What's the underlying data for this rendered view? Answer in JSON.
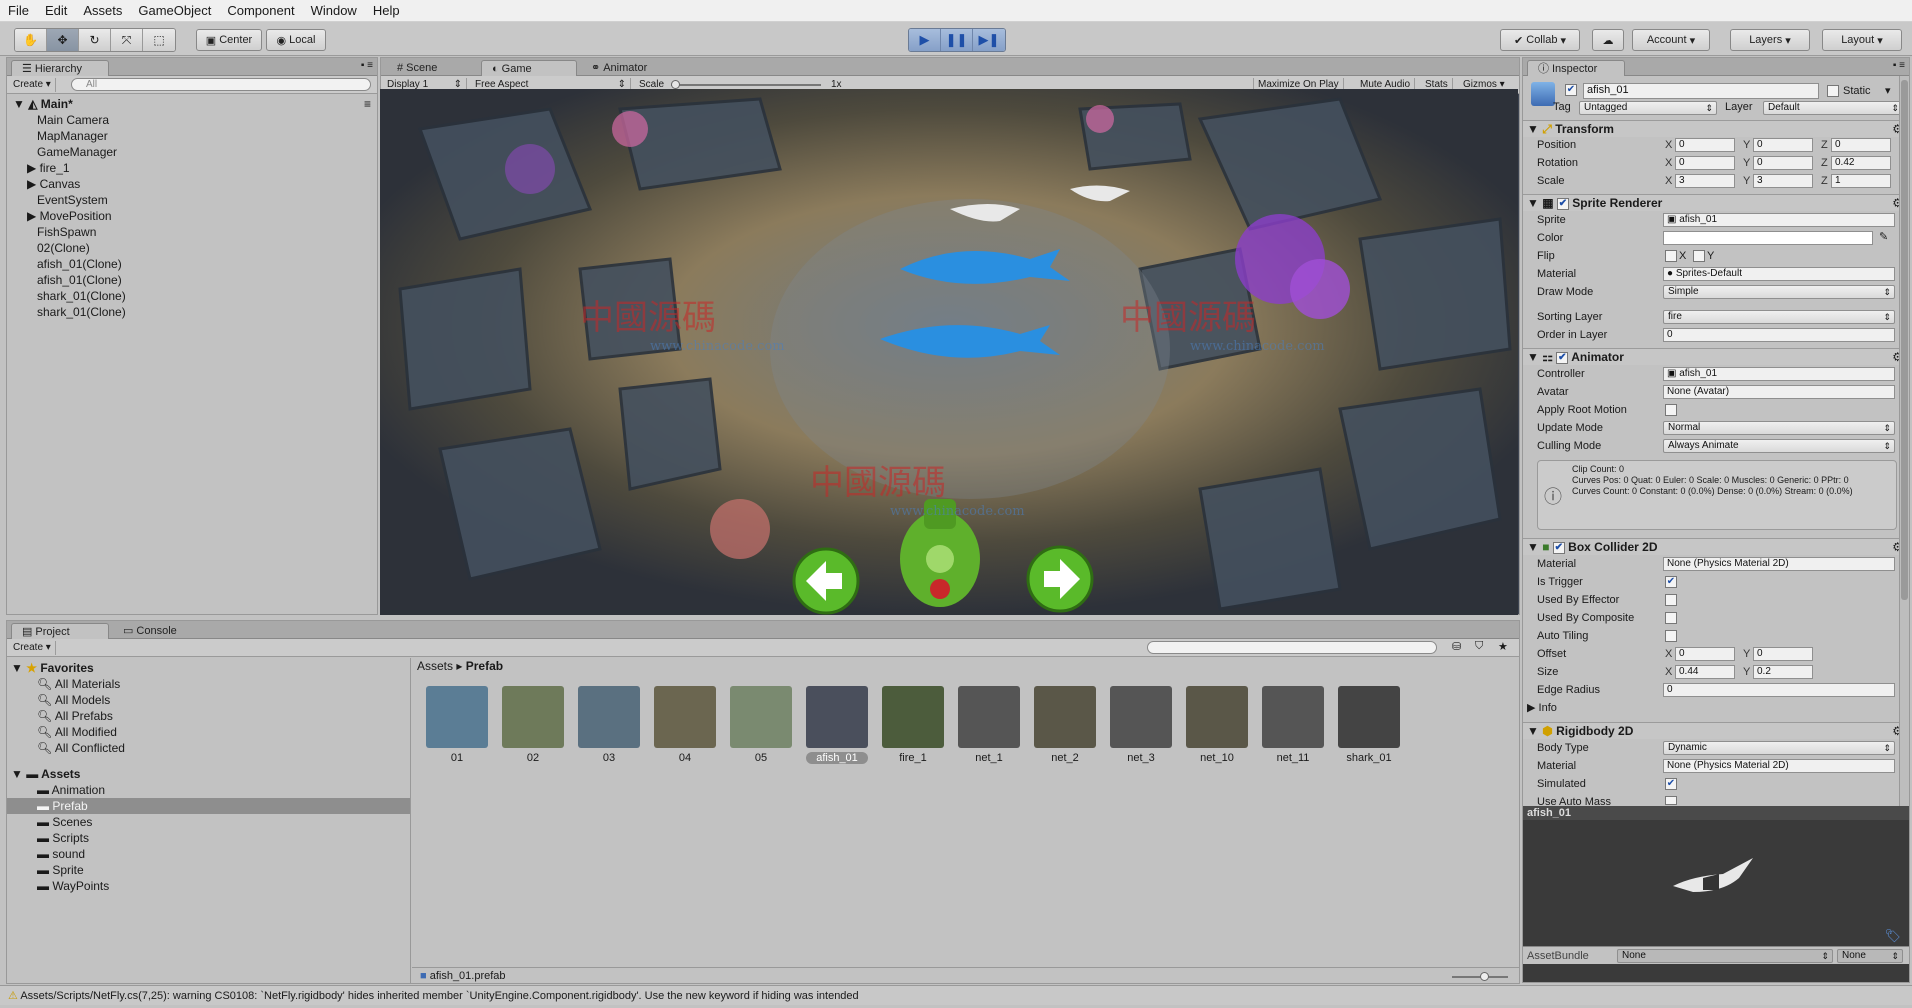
{
  "menu": [
    "File",
    "Edit",
    "Assets",
    "GameObject",
    "Component",
    "Window",
    "Help"
  ],
  "toolbar": {
    "center": "Center",
    "local": "Local",
    "collab": "Collab",
    "account": "Account",
    "layers": "Layers",
    "layout": "Layout"
  },
  "hierarchy": {
    "tab": "Hierarchy",
    "create": "Create",
    "search_placeholder": "All",
    "scene": "Main*",
    "items": [
      "Main Camera",
      "MapManager",
      "GameManager",
      "fire_1",
      "Canvas",
      "EventSystem",
      "MovePosition",
      "FishSpawn",
      "02(Clone)",
      "afish_01(Clone)",
      "afish_01(Clone)",
      "shark_01(Clone)",
      "shark_01(Clone)"
    ]
  },
  "game": {
    "tabs": [
      "Scene",
      "Game",
      "Animator"
    ],
    "display": "Display 1",
    "aspect": "Free Aspect",
    "scale_label": "Scale",
    "scale_value": "1x",
    "maximize": "Maximize On Play",
    "mute": "Mute Audio",
    "stats": "Stats",
    "gizmos": "Gizmos"
  },
  "watermark": {
    "cn": "中國源碼",
    "url": "www.chinacode.com"
  },
  "project": {
    "tabs": [
      "Project",
      "Console"
    ],
    "create": "Create",
    "favorites_label": "Favorites",
    "favorites": [
      "All Materials",
      "All Models",
      "All Prefabs",
      "All Modified",
      "All Conflicted"
    ],
    "assets_label": "Assets",
    "folders": [
      "Animation",
      "Prefab",
      "Scenes",
      "Scripts",
      "sound",
      "Sprite",
      "WayPoints"
    ],
    "breadcrumb_root": "Assets",
    "breadcrumb_current": "Prefab",
    "assets": [
      "01",
      "02",
      "03",
      "04",
      "05",
      "afish_01",
      "fire_1",
      "net_1",
      "net_2",
      "net_3",
      "net_10",
      "net_11",
      "shark_01"
    ],
    "selected_file": "afish_01.prefab"
  },
  "inspector": {
    "tab": "Inspector",
    "object_name": "afish_01",
    "static": "Static",
    "tag_label": "Tag",
    "tag": "Untagged",
    "layer_label": "Layer",
    "layer": "Default",
    "transform": {
      "title": "Transform",
      "position_label": "Position",
      "position": [
        "0",
        "0",
        "0"
      ],
      "rotation_label": "Rotation",
      "rotation": [
        "0",
        "0",
        "0.42"
      ],
      "scale_label": "Scale",
      "scale": [
        "3",
        "3",
        "1"
      ]
    },
    "sprite_renderer": {
      "title": "Sprite Renderer",
      "sprite_label": "Sprite",
      "sprite": "afish_01",
      "color_label": "Color",
      "flip_label": "Flip",
      "flip_x": "X",
      "flip_y": "Y",
      "material_label": "Material",
      "material": "Sprites-Default",
      "draw_mode_label": "Draw Mode",
      "draw_mode": "Simple",
      "sorting_layer_label": "Sorting Layer",
      "sorting_layer": "fire",
      "order_label": "Order in Layer",
      "order": "0"
    },
    "animator": {
      "title": "Animator",
      "controller_label": "Controller",
      "controller": "afish_01",
      "avatar_label": "Avatar",
      "avatar": "None (Avatar)",
      "root_motion_label": "Apply Root Motion",
      "update_mode_label": "Update Mode",
      "update_mode": "Normal",
      "culling_label": "Culling Mode",
      "culling": "Always Animate",
      "info1": "Clip Count: 0",
      "info2": "Curves Pos: 0 Quat: 0 Euler: 0 Scale: 0 Muscles: 0 Generic: 0 PPtr: 0",
      "info3": "Curves Count: 0 Constant: 0 (0.0%) Dense: 0 (0.0%) Stream: 0 (0.0%)"
    },
    "box_collider": {
      "title": "Box Collider 2D",
      "material_label": "Material",
      "material": "None (Physics Material 2D)",
      "trigger_label": "Is Trigger",
      "effector_label": "Used By Effector",
      "composite_label": "Used By Composite",
      "tiling_label": "Auto Tiling",
      "offset_label": "Offset",
      "offset": [
        "0",
        "0"
      ],
      "size_label": "Size",
      "size": [
        "0.44",
        "0.2"
      ],
      "edge_label": "Edge Radius",
      "edge": "0",
      "info_label": "Info"
    },
    "rigidbody": {
      "title": "Rigidbody 2D",
      "body_type_label": "Body Type",
      "body_type": "Dynamic",
      "material_label": "Material",
      "material": "None (Physics Material 2D)",
      "simulated_label": "Simulated",
      "auto_mass_label": "Use Auto Mass"
    },
    "preview_title": "afish_01",
    "assetbundle_label": "AssetBundle",
    "assetbundle": "None",
    "assetbundle_variant": "None"
  },
  "status": "Assets/Scripts/NetFly.cs(7,25): warning CS0108: `NetFly.rigidbody' hides inherited member `UnityEngine.Component.rigidbody'. Use the new keyword if hiding was intended",
  "colors": {
    "accent": "#3d6bb3",
    "selected": "#8e8e8e"
  }
}
